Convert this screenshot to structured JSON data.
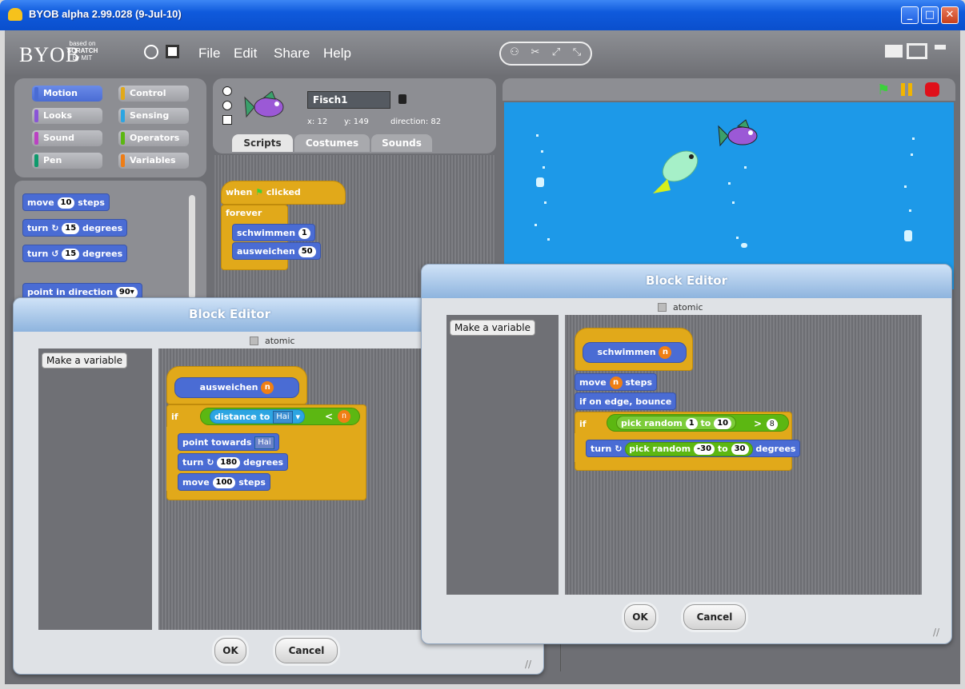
{
  "window": {
    "title": "BYOB alpha 2.99.028 (9-Jul-10)"
  },
  "logo": {
    "text": "BYOB",
    "sub_line1": "based on",
    "sub_line2": "SCRATCH",
    "sub_line3": "by MIT"
  },
  "menu": {
    "file": "File",
    "edit": "Edit",
    "share": "Share",
    "help": "Help"
  },
  "categories": {
    "motion": "Motion",
    "control": "Control",
    "looks": "Looks",
    "sensing": "Sensing",
    "sound": "Sound",
    "operators": "Operators",
    "pen": "Pen",
    "variables": "Variables"
  },
  "palette": {
    "move_a": "move",
    "move_n": "10",
    "move_b": "steps",
    "turn_cw_a": "turn",
    "turn_cw_n": "15",
    "turn_cw_b": "degrees",
    "turn_ccw_a": "turn",
    "turn_ccw_n": "15",
    "turn_ccw_b": "degrees",
    "point_dir_a": "point in direction",
    "point_dir_n": "90▾"
  },
  "sprite": {
    "name": "Fisch1",
    "x_label": "x: 12",
    "y_label": "y: 149",
    "dir_label": "direction: 82"
  },
  "tabs": {
    "scripts": "Scripts",
    "costumes": "Costumes",
    "sounds": "Sounds"
  },
  "script": {
    "hat_a": "when",
    "hat_b": "clicked",
    "forever": "forever",
    "schwimmen": "schwimmen",
    "schwimmen_n": "1",
    "ausweichen": "ausweichen",
    "ausweichen_n": "50"
  },
  "dialog_left": {
    "title": "Block Editor",
    "atomic": "atomic",
    "make_var": "Make a variable",
    "hat": "ausweichen",
    "hat_param": "n",
    "if": "if",
    "distance": "distance to",
    "distance_target": "Hai",
    "lt": "<",
    "lt_param": "n",
    "point_towards": "point towards",
    "point_target": "Hai",
    "turn_a": "turn",
    "turn_n": "180",
    "turn_b": "degrees",
    "move_a": "move",
    "move_n": "100",
    "move_b": "steps",
    "ok": "OK",
    "cancel": "Cancel"
  },
  "dialog_right": {
    "title": "Block Editor",
    "atomic": "atomic",
    "make_var": "Make a variable",
    "hat": "schwimmen",
    "hat_param": "n",
    "move_a": "move",
    "move_param": "n",
    "move_b": "steps",
    "bounce": "if on edge, bounce",
    "if": "if",
    "pick": "pick random",
    "pick_from": "1",
    "to": "to",
    "pick_to": "10",
    "gt": ">",
    "gt_val": "8",
    "turn_a": "turn",
    "turn_pick": "pick random",
    "turn_from": "-30",
    "turn_to_word": "to",
    "turn_to": "30",
    "turn_b": "degrees",
    "ok": "OK",
    "cancel": "Cancel"
  },
  "colors": {
    "motion": "#4a6cd4",
    "control": "#e1a91a",
    "operators": "#5cb712",
    "sensing": "#2ca5e2",
    "stage": "#1d99e8"
  }
}
